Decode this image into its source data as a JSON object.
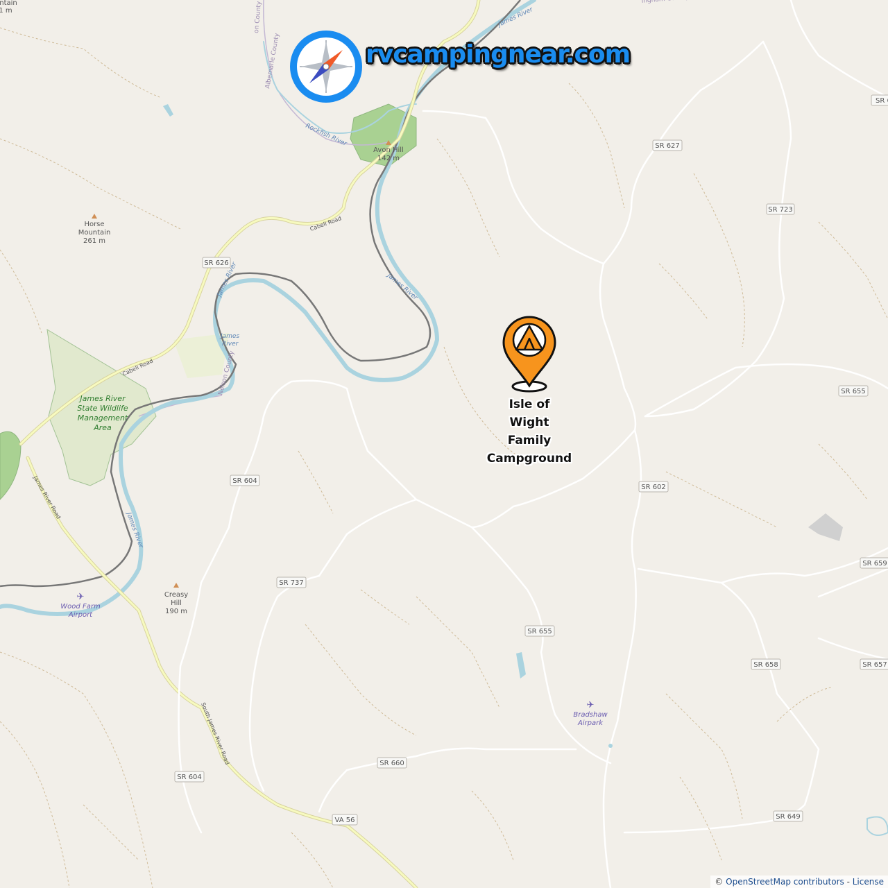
{
  "branding": {
    "site_name": "rvcampingnear.com",
    "logo_icon": "compass-icon"
  },
  "campground": {
    "name_lines": [
      "Isle of",
      "Wight",
      "Family",
      "Campground"
    ],
    "marker_icon": "tent-pin-icon",
    "marker_color": "#f7941d"
  },
  "attribution": {
    "symbol": "©",
    "osm": "OpenStreetMap contributors",
    "separator": "-",
    "license": "License"
  },
  "road_shields": [
    "SR 627",
    "SR 723",
    "SR 626",
    "SR 655",
    "SR 604",
    "SR 602",
    "SR 659",
    "SR 737",
    "SR 655",
    "SR 658",
    "SR 657",
    "SR 660",
    "SR 604",
    "VA 56",
    "SR 649",
    "SR 6"
  ],
  "peaks": [
    {
      "name": "Horse\nMountain",
      "elevation": "261 m"
    },
    {
      "name": "Avon Hill",
      "elevation": "142 m"
    },
    {
      "name": "Creasy\nHill",
      "elevation": "190 m"
    },
    {
      "name": "...ntain",
      "elevation": "...1 m"
    }
  ],
  "water_labels": [
    "James River",
    "James River",
    "James River",
    "James River",
    "James River",
    "Rockfish River"
  ],
  "road_labels": [
    "Cabell Road",
    "Cabell Road",
    "James River Road",
    "South James River Road"
  ],
  "county_labels": [
    "Albemarle County",
    "Nelson County",
    "Nelson County",
    "...ingham County"
  ],
  "parks": [
    {
      "name": "James River State Wildlife Management Area"
    }
  ],
  "airports": [
    {
      "name": "Wood Farm Airport"
    },
    {
      "name": "Bradshaw Airpark"
    }
  ],
  "colors": {
    "land": "#f2efe9",
    "water": "#aad3df",
    "park": "#c8e6a8",
    "road_yellow": "#f7fabf",
    "river_label": "#5d86b6"
  }
}
